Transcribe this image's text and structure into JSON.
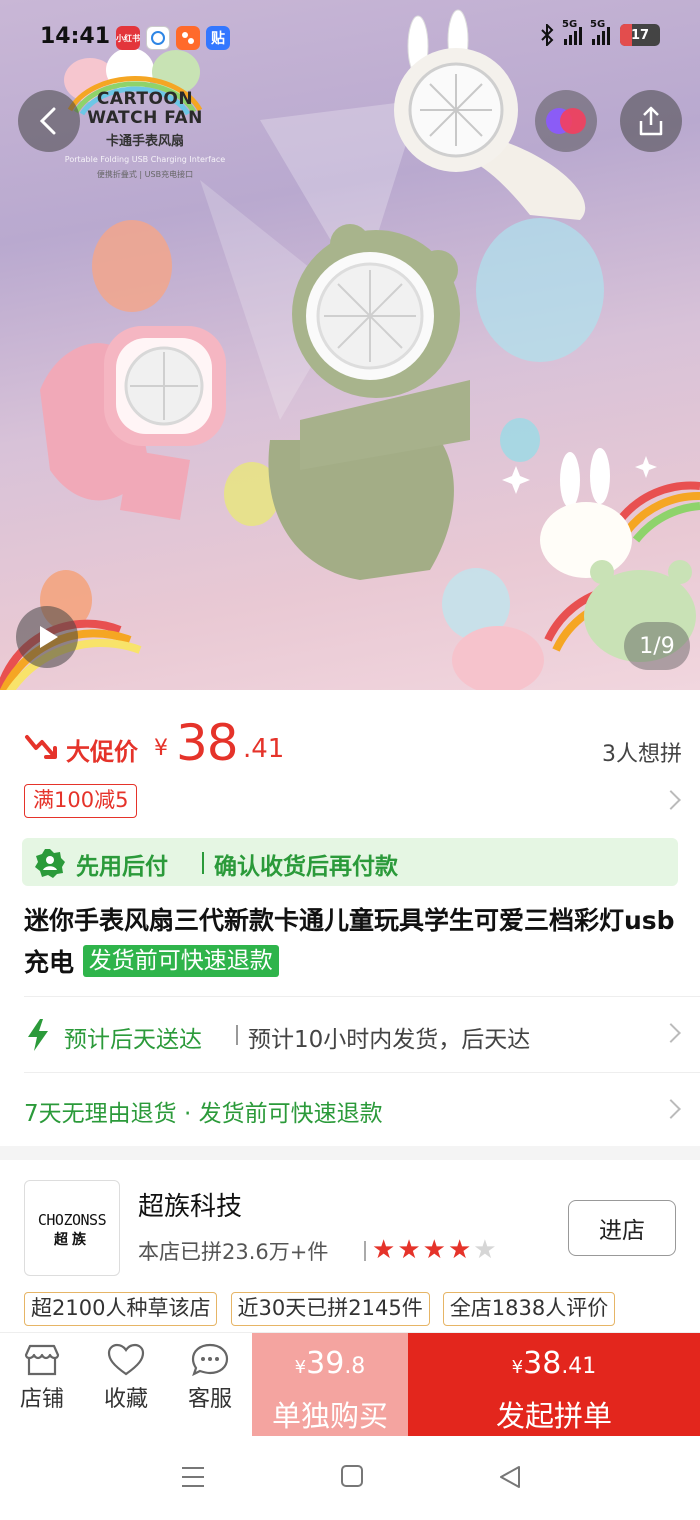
{
  "status_bar": {
    "time": "14:41",
    "app_badges": [
      {
        "icon": "xiaohongshu-app-icon",
        "text": "小红书",
        "color": "#e3353b"
      },
      {
        "icon": "ai-assistant-app-icon",
        "text": "",
        "color": "#2e86e5"
      },
      {
        "icon": "shopping-app-icon",
        "text": "",
        "color": "#ff6a2b"
      },
      {
        "icon": "tieba-app-icon",
        "text": "贴",
        "color": "#3377ff"
      }
    ],
    "network_1": "5G",
    "network_2": "5G",
    "battery": "17"
  },
  "hero": {
    "brand_line1": "CARTOON",
    "brand_line2": "WATCH FAN",
    "brand_cn": "卡通手表风扇",
    "brand_en_sub": "Portable Folding USB Charging Interface",
    "brand_tags": "便携折叠式 | USB充电接口",
    "pager": "1/9"
  },
  "price": {
    "promo_label": "大促价",
    "symbol": "¥",
    "integer": "38",
    "decimal": ".41",
    "wish_count": "3人想拼"
  },
  "coupon": {
    "label": "满100减5"
  },
  "pay_later": {
    "label": "先用后付",
    "desc": "确认收货后再付款"
  },
  "product": {
    "title": "迷你手表风扇三代新款卡通儿童玩具学生可爱三档彩灯usb充电",
    "refund_tag": "发货前可快速退款"
  },
  "shipping": {
    "label": "预计后天送达",
    "desc": "预计10小时内发货，后天达"
  },
  "returns": {
    "text": "7天无理由退货 · 发货前可快速退款"
  },
  "store": {
    "logo_en": "CHOZONSS",
    "logo_cn": "超族",
    "name": "超族科技",
    "sales": "本店已拼23.6万+件",
    "rating": 4,
    "rating_max": 5,
    "enter_label": "进店",
    "tags": [
      "超2100人种草该店",
      "近30天已拼2145件",
      "全店1838人评价"
    ]
  },
  "action_bar": {
    "store_label": "店铺",
    "favorite_label": "收藏",
    "service_label": "客服",
    "solo": {
      "symbol": "¥",
      "integer": "39",
      "decimal": ".8",
      "label": "单独购买"
    },
    "group": {
      "symbol": "¥",
      "integer": "38",
      "decimal": ".41",
      "label": "发起拼单"
    }
  },
  "colors": {
    "accent_red": "#e5332a",
    "green": "#2b9a3a",
    "solo_bg": "#f4a4a0",
    "group_bg": "#e3261d"
  }
}
